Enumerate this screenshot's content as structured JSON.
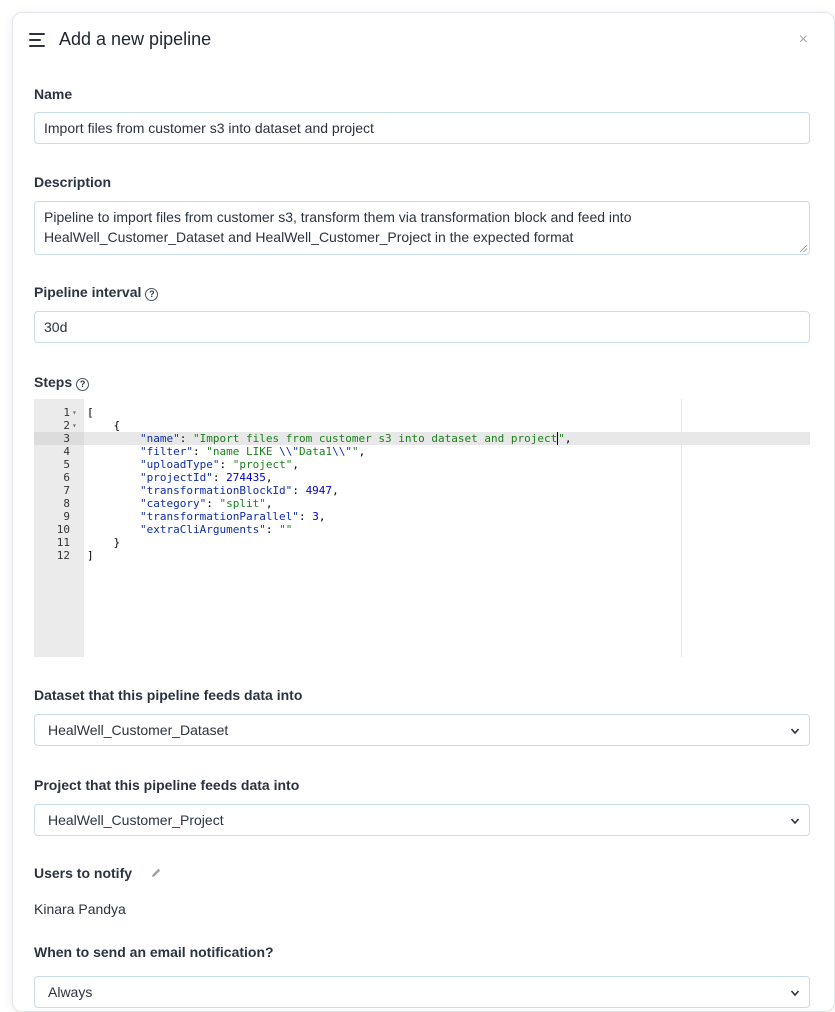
{
  "dialog": {
    "title": "Add a new pipeline",
    "close_glyph": "×",
    "icons": {
      "menu": "hamburger-menu-icon",
      "close": "close-icon"
    }
  },
  "form": {
    "name": {
      "label": "Name",
      "value": "Import files from customer s3 into dataset and project"
    },
    "description": {
      "label": "Description",
      "value": "Pipeline to import files from customer s3, transform them via transformation block and feed into HealWell_Customer_Dataset and HealWell_Customer_Project in the expected format"
    },
    "interval": {
      "label": "Pipeline interval",
      "value": "30d",
      "help_glyph": "?"
    },
    "steps": {
      "label": "Steps",
      "help_glyph": "?",
      "active_line": 3,
      "lines": [
        {
          "n": "1",
          "fold": "▾",
          "html": "["
        },
        {
          "n": "2",
          "fold": "▾",
          "html": "    {"
        },
        {
          "n": "3",
          "fold": "",
          "html": "        <span class=\"k\">\"name\"</span>: <span class=\"s\">\"Import files from customer s3 into dataset and project<span class=\"cursor\"></span>\"</span>,"
        },
        {
          "n": "4",
          "fold": "",
          "html": "        <span class=\"k\">\"filter\"</span>: <span class=\"s\">\"name LIKE <span class=\"k\">\\\\\"</span>Data1<span class=\"k\">\\\\\"</span>\"</span>,"
        },
        {
          "n": "5",
          "fold": "",
          "html": "        <span class=\"k\">\"uploadType\"</span>: <span class=\"s\">\"project\"</span>,"
        },
        {
          "n": "6",
          "fold": "",
          "html": "        <span class=\"k\">\"projectId\"</span>: <span class=\"n\">274435</span>,"
        },
        {
          "n": "7",
          "fold": "",
          "html": "        <span class=\"k\">\"transformationBlockId\"</span>: <span class=\"n\">4947</span>,"
        },
        {
          "n": "8",
          "fold": "",
          "html": "        <span class=\"k\">\"category\"</span>: <span class=\"s\">\"split\"</span>,"
        },
        {
          "n": "9",
          "fold": "",
          "html": "        <span class=\"k\">\"transformationParallel\"</span>: <span class=\"n\">3</span>,"
        },
        {
          "n": "10",
          "fold": "",
          "html": "        <span class=\"k\">\"extraCliArguments\"</span>: <span class=\"s\">\"\"</span>"
        },
        {
          "n": "11",
          "fold": "",
          "html": "    }"
        },
        {
          "n": "12",
          "fold": "",
          "html": "]"
        }
      ]
    },
    "dataset": {
      "label": "Dataset that this pipeline feeds data into",
      "selected": "HealWell_Customer_Dataset"
    },
    "project": {
      "label": "Project that this pipeline feeds data into",
      "selected": "HealWell_Customer_Project"
    },
    "notify": {
      "label": "Users to notify",
      "users": "Kinara Pandya",
      "edit_icon": "pencil-icon"
    },
    "email_when": {
      "label": "When to send an email notification?",
      "selected": "Always"
    }
  },
  "colors": {
    "input_border": "#c9dbe6",
    "gutter_bg": "#ebebeb",
    "json_key": "#0e2da8",
    "json_string": "#1a7f1a",
    "json_number": "#0000cd"
  }
}
